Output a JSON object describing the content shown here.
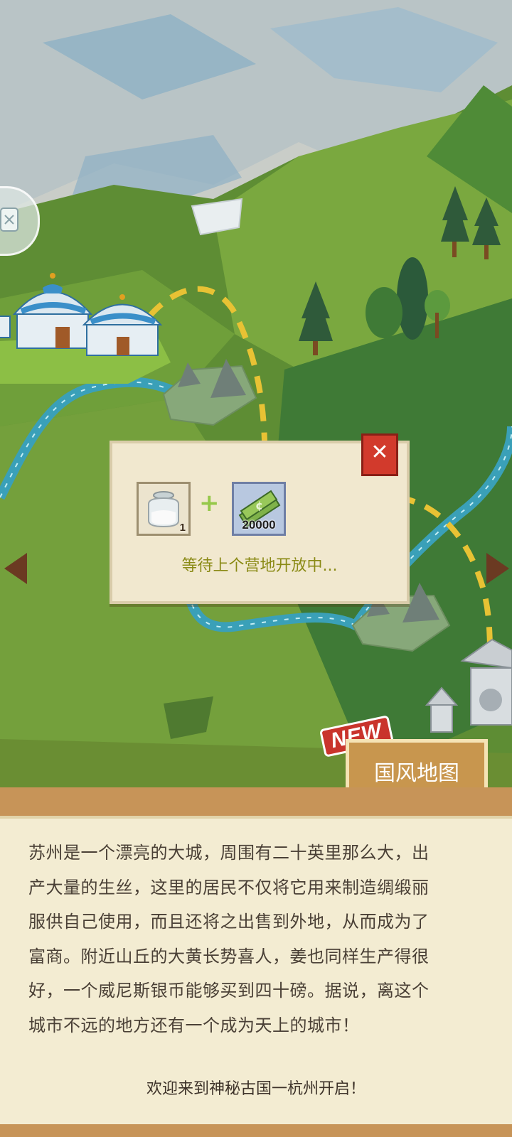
{
  "popup": {
    "close_icon": "close-icon",
    "item1": {
      "icon": "sugar-jar-icon",
      "quantity": "1"
    },
    "plus_sign": "+",
    "item2": {
      "icon": "cash-bundle-icon",
      "quantity": "20000"
    },
    "status": "等待上个营地开放中..."
  },
  "map_button": {
    "badge": "NEW",
    "label": "国风地图"
  },
  "description": {
    "lines": [
      "苏州是一个漂亮的大城，周围有二十英里那么大，出",
      "产大量的生丝，这里的居民不仅将它用来制造绸缎丽",
      "服供自己使用，而且还将之出售到外地，从而成为了",
      "富商。附近山丘的大黄长势喜人，姜也同样生产得很",
      "好，一个威尼斯银币能够买到四十磅。据说，离这个",
      "城市不远的地方还有一个成为天上的城市！"
    ],
    "footer": "欢迎来到神秘古国一杭州开启！"
  },
  "colors": {
    "grass": "#6f9a3a",
    "river": "#3aa0b8",
    "path": "#e8c234",
    "parchment": "#f3ecd2",
    "close_red": "#d23a2c",
    "status_text": "#8a8a15"
  }
}
